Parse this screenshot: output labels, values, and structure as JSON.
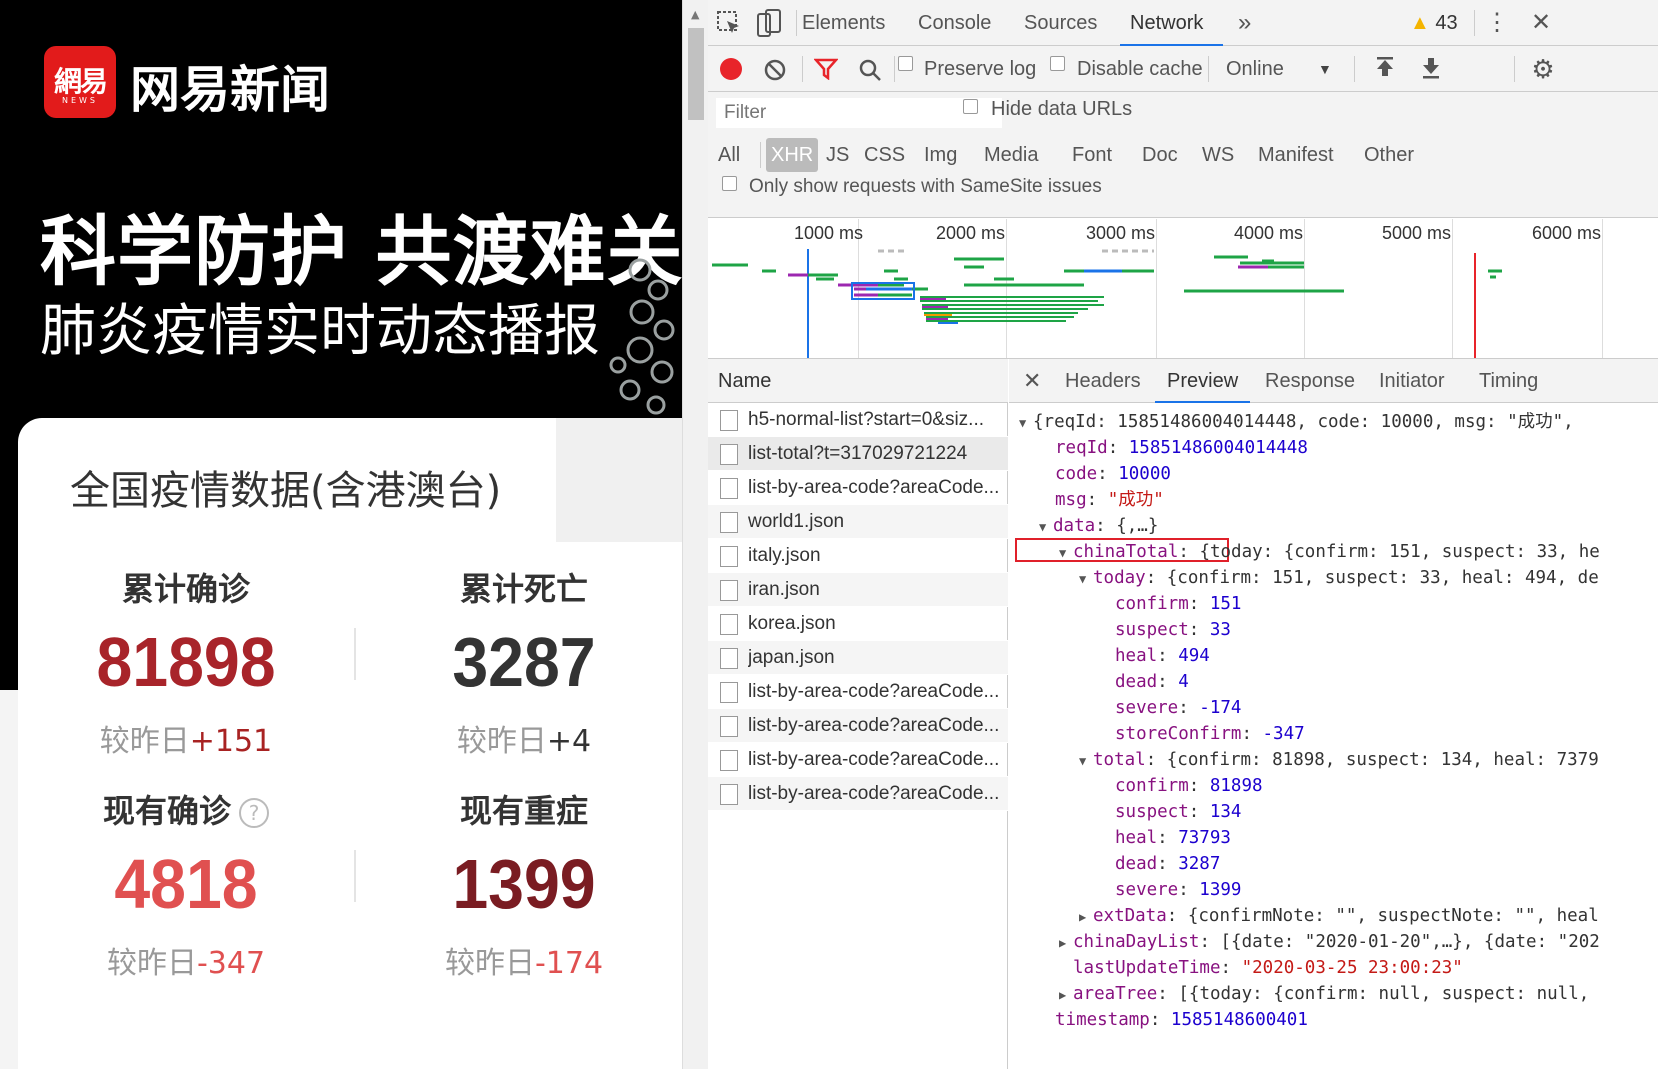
{
  "mobile": {
    "logo_main": "網易",
    "logo_sub": "NEWS",
    "brand_name": "网易新闻",
    "hero_title": "科学防护 共渡难关",
    "hero_subtitle": "肺炎疫情实时动态播报",
    "card_title": "全国疫情数据(含港澳台)",
    "stats": [
      {
        "label": "累计确诊",
        "value": "81898",
        "compare_prefix": "较昨日",
        "compare_value": "+151",
        "color": "#a8242a"
      },
      {
        "label": "累计死亡",
        "value": "3287",
        "compare_prefix": "较昨日",
        "compare_value": "+4",
        "color": "#333333"
      },
      {
        "label": "现有确诊",
        "value": "4818",
        "compare_prefix": "较昨日",
        "compare_value": "-347",
        "color": "#e05050",
        "help_icon": "?"
      },
      {
        "label": "现有重症",
        "value": "1399",
        "compare_prefix": "较昨日",
        "compare_value": "-174",
        "color": "#7a1c22"
      }
    ]
  },
  "devtools": {
    "tabs": [
      "Elements",
      "Console",
      "Sources",
      "Network"
    ],
    "active_tab": "Network",
    "more_tabs": "»",
    "warning_count": "43",
    "toolbar": {
      "preserve_log": "Preserve log",
      "disable_cache": "Disable cache",
      "throttle": "Online"
    },
    "filter": {
      "placeholder": "Filter",
      "hide_data_urls": "Hide data URLs",
      "types": [
        "All",
        "XHR",
        "JS",
        "CSS",
        "Img",
        "Media",
        "Font",
        "Doc",
        "WS",
        "Manifest",
        "Other"
      ],
      "active_type": "XHR",
      "samesite": "Only show requests with SameSite issues"
    },
    "timeline_labels": [
      "1000 ms",
      "2000 ms",
      "3000 ms",
      "4000 ms",
      "5000 ms",
      "6000 ms"
    ],
    "list_header": "Name",
    "requests": [
      "h5-normal-list?start=0&siz...",
      "list-total?t=317029721224",
      "list-by-area-code?areaCode...",
      "world1.json",
      "italy.json",
      "iran.json",
      "korea.json",
      "japan.json",
      "list-by-area-code?areaCode...",
      "list-by-area-code?areaCode...",
      "list-by-area-code?areaCode...",
      "list-by-area-code?areaCode..."
    ],
    "selected_request": 1,
    "detail_tabs": [
      "Headers",
      "Preview",
      "Response",
      "Initiator",
      "Timing"
    ],
    "active_detail_tab": "Preview",
    "preview": {
      "l01": "{reqId: 15851486004014448, code: 10000, msg: \"成功\",",
      "l02k": "reqId",
      "l02v": "15851486004014448",
      "l03k": "code",
      "l03v": "10000",
      "l04k": "msg",
      "l04v": "\"成功\"",
      "l05k": "data",
      "l05v": "{,…}",
      "l06k": "chinaTotal",
      "l06v": "{today: {confirm: 151, suspect: 33, he",
      "l07k": "today",
      "l07v": "{confirm: 151, suspect: 33, heal: 494, de",
      "l08k": "confirm",
      "l08v": "151",
      "l09k": "suspect",
      "l09v": "33",
      "l10k": "heal",
      "l10v": "494",
      "l11k": "dead",
      "l11v": "4",
      "l12k": "severe",
      "l12v": "-174",
      "l13k": "storeConfirm",
      "l13v": "-347",
      "l14k": "total",
      "l14v": "{confirm: 81898, suspect: 134, heal: 7379",
      "l15k": "confirm",
      "l15v": "81898",
      "l16k": "suspect",
      "l16v": "134",
      "l17k": "heal",
      "l17v": "73793",
      "l18k": "dead",
      "l18v": "3287",
      "l19k": "severe",
      "l19v": "1399",
      "l20k": "extData",
      "l20v": "{confirmNote: \"\", suspectNote: \"\", heal",
      "l21k": "chinaDayList",
      "l21v": "[{date: \"2020-01-20\",…}, {date: \"202",
      "l22k": "lastUpdateTime",
      "l22v": "\"2020-03-25 23:00:23\"",
      "l23k": "areaTree",
      "l23v": "[{today: {confirm: null, suspect: null,",
      "l24k": "timestamp",
      "l24v": "1585148600401"
    }
  }
}
